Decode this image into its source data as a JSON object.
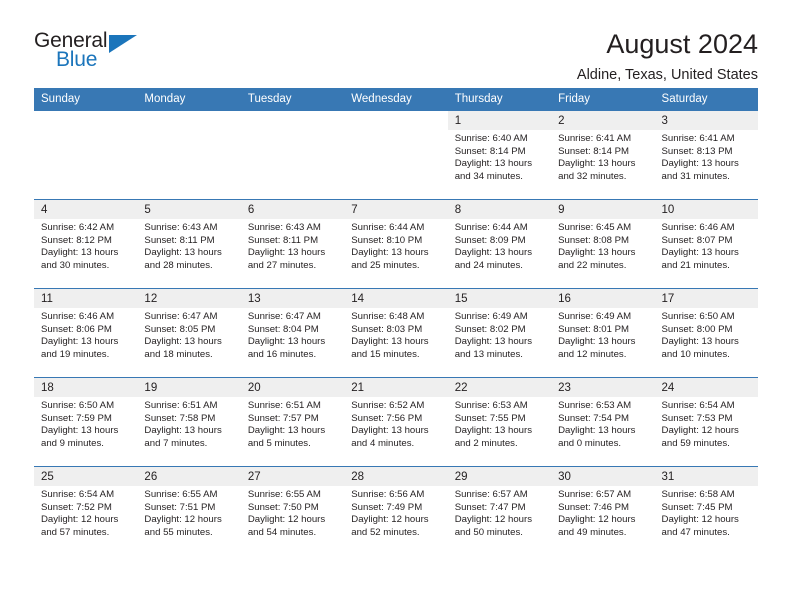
{
  "brand": {
    "name_part1": "General",
    "name_part2": "Blue",
    "logo_icon": "blue-triangle-icon"
  },
  "header": {
    "title": "August 2024",
    "subtitle": "Aldine, Texas, United States"
  },
  "calendar": {
    "weekday_headers": [
      "Sunday",
      "Monday",
      "Tuesday",
      "Wednesday",
      "Thursday",
      "Friday",
      "Saturday"
    ],
    "accent_color": "#3878b4",
    "daynum_band_color": "#efefef",
    "weeks": [
      [
        {
          "day": "",
          "lines": []
        },
        {
          "day": "",
          "lines": []
        },
        {
          "day": "",
          "lines": []
        },
        {
          "day": "",
          "lines": []
        },
        {
          "day": "1",
          "lines": [
            "Sunrise: 6:40 AM",
            "Sunset: 8:14 PM",
            "Daylight: 13 hours",
            "and 34 minutes."
          ]
        },
        {
          "day": "2",
          "lines": [
            "Sunrise: 6:41 AM",
            "Sunset: 8:14 PM",
            "Daylight: 13 hours",
            "and 32 minutes."
          ]
        },
        {
          "day": "3",
          "lines": [
            "Sunrise: 6:41 AM",
            "Sunset: 8:13 PM",
            "Daylight: 13 hours",
            "and 31 minutes."
          ]
        }
      ],
      [
        {
          "day": "4",
          "lines": [
            "Sunrise: 6:42 AM",
            "Sunset: 8:12 PM",
            "Daylight: 13 hours",
            "and 30 minutes."
          ]
        },
        {
          "day": "5",
          "lines": [
            "Sunrise: 6:43 AM",
            "Sunset: 8:11 PM",
            "Daylight: 13 hours",
            "and 28 minutes."
          ]
        },
        {
          "day": "6",
          "lines": [
            "Sunrise: 6:43 AM",
            "Sunset: 8:11 PM",
            "Daylight: 13 hours",
            "and 27 minutes."
          ]
        },
        {
          "day": "7",
          "lines": [
            "Sunrise: 6:44 AM",
            "Sunset: 8:10 PM",
            "Daylight: 13 hours",
            "and 25 minutes."
          ]
        },
        {
          "day": "8",
          "lines": [
            "Sunrise: 6:44 AM",
            "Sunset: 8:09 PM",
            "Daylight: 13 hours",
            "and 24 minutes."
          ]
        },
        {
          "day": "9",
          "lines": [
            "Sunrise: 6:45 AM",
            "Sunset: 8:08 PM",
            "Daylight: 13 hours",
            "and 22 minutes."
          ]
        },
        {
          "day": "10",
          "lines": [
            "Sunrise: 6:46 AM",
            "Sunset: 8:07 PM",
            "Daylight: 13 hours",
            "and 21 minutes."
          ]
        }
      ],
      [
        {
          "day": "11",
          "lines": [
            "Sunrise: 6:46 AM",
            "Sunset: 8:06 PM",
            "Daylight: 13 hours",
            "and 19 minutes."
          ]
        },
        {
          "day": "12",
          "lines": [
            "Sunrise: 6:47 AM",
            "Sunset: 8:05 PM",
            "Daylight: 13 hours",
            "and 18 minutes."
          ]
        },
        {
          "day": "13",
          "lines": [
            "Sunrise: 6:47 AM",
            "Sunset: 8:04 PM",
            "Daylight: 13 hours",
            "and 16 minutes."
          ]
        },
        {
          "day": "14",
          "lines": [
            "Sunrise: 6:48 AM",
            "Sunset: 8:03 PM",
            "Daylight: 13 hours",
            "and 15 minutes."
          ]
        },
        {
          "day": "15",
          "lines": [
            "Sunrise: 6:49 AM",
            "Sunset: 8:02 PM",
            "Daylight: 13 hours",
            "and 13 minutes."
          ]
        },
        {
          "day": "16",
          "lines": [
            "Sunrise: 6:49 AM",
            "Sunset: 8:01 PM",
            "Daylight: 13 hours",
            "and 12 minutes."
          ]
        },
        {
          "day": "17",
          "lines": [
            "Sunrise: 6:50 AM",
            "Sunset: 8:00 PM",
            "Daylight: 13 hours",
            "and 10 minutes."
          ]
        }
      ],
      [
        {
          "day": "18",
          "lines": [
            "Sunrise: 6:50 AM",
            "Sunset: 7:59 PM",
            "Daylight: 13 hours",
            "and 9 minutes."
          ]
        },
        {
          "day": "19",
          "lines": [
            "Sunrise: 6:51 AM",
            "Sunset: 7:58 PM",
            "Daylight: 13 hours",
            "and 7 minutes."
          ]
        },
        {
          "day": "20",
          "lines": [
            "Sunrise: 6:51 AM",
            "Sunset: 7:57 PM",
            "Daylight: 13 hours",
            "and 5 minutes."
          ]
        },
        {
          "day": "21",
          "lines": [
            "Sunrise: 6:52 AM",
            "Sunset: 7:56 PM",
            "Daylight: 13 hours",
            "and 4 minutes."
          ]
        },
        {
          "day": "22",
          "lines": [
            "Sunrise: 6:53 AM",
            "Sunset: 7:55 PM",
            "Daylight: 13 hours",
            "and 2 minutes."
          ]
        },
        {
          "day": "23",
          "lines": [
            "Sunrise: 6:53 AM",
            "Sunset: 7:54 PM",
            "Daylight: 13 hours",
            "and 0 minutes."
          ]
        },
        {
          "day": "24",
          "lines": [
            "Sunrise: 6:54 AM",
            "Sunset: 7:53 PM",
            "Daylight: 12 hours",
            "and 59 minutes."
          ]
        }
      ],
      [
        {
          "day": "25",
          "lines": [
            "Sunrise: 6:54 AM",
            "Sunset: 7:52 PM",
            "Daylight: 12 hours",
            "and 57 minutes."
          ]
        },
        {
          "day": "26",
          "lines": [
            "Sunrise: 6:55 AM",
            "Sunset: 7:51 PM",
            "Daylight: 12 hours",
            "and 55 minutes."
          ]
        },
        {
          "day": "27",
          "lines": [
            "Sunrise: 6:55 AM",
            "Sunset: 7:50 PM",
            "Daylight: 12 hours",
            "and 54 minutes."
          ]
        },
        {
          "day": "28",
          "lines": [
            "Sunrise: 6:56 AM",
            "Sunset: 7:49 PM",
            "Daylight: 12 hours",
            "and 52 minutes."
          ]
        },
        {
          "day": "29",
          "lines": [
            "Sunrise: 6:57 AM",
            "Sunset: 7:47 PM",
            "Daylight: 12 hours",
            "and 50 minutes."
          ]
        },
        {
          "day": "30",
          "lines": [
            "Sunrise: 6:57 AM",
            "Sunset: 7:46 PM",
            "Daylight: 12 hours",
            "and 49 minutes."
          ]
        },
        {
          "day": "31",
          "lines": [
            "Sunrise: 6:58 AM",
            "Sunset: 7:45 PM",
            "Daylight: 12 hours",
            "and 47 minutes."
          ]
        }
      ]
    ]
  }
}
